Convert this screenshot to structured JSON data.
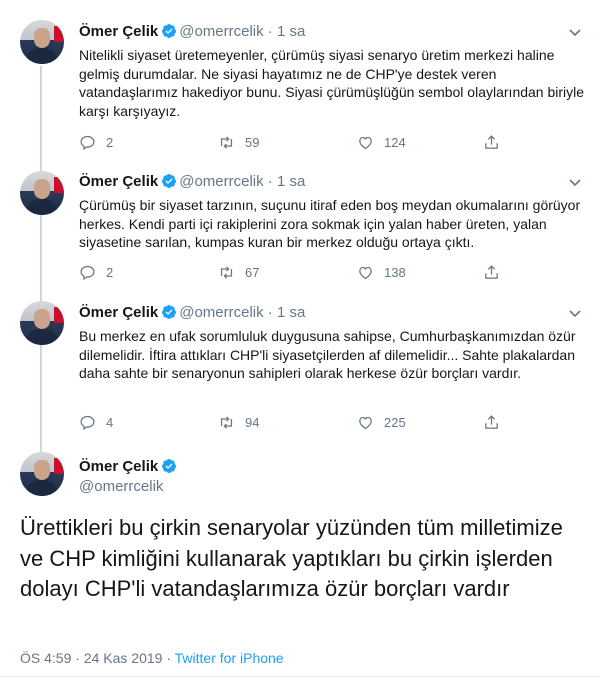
{
  "tweets": [
    {
      "name": "Ömer Çelik",
      "handle": "@omerrcelik",
      "dot": "·",
      "time": "1 sa",
      "text": "Nitelikli siyaset üretemeyenler, çürümüş siyasi senaryo üretim merkezi haline gelmiş durumdalar. Ne siyasi hayatımız ne de CHP'ye destek veren vatandaşlarımız hakediyor bunu. Siyasi çürümüşlüğün sembol olaylarından biriyle karşı karşıyayız.",
      "replies": "2",
      "retweets": "59",
      "likes": "124"
    },
    {
      "name": "Ömer Çelik",
      "handle": "@omerrcelik",
      "dot": "·",
      "time": "1 sa",
      "text": "Çürümüş bir siyaset tarzının, suçunu itiraf eden boş meydan okumalarını görüyor herkes. Kendi parti içi rakiplerini zora sokmak için yalan haber üreten, yalan siyasetine sarılan, kumpas kuran bir merkez olduğu ortaya çıktı.",
      "replies": "2",
      "retweets": "67",
      "likes": "138"
    },
    {
      "name": "Ömer Çelik",
      "handle": "@omerrcelik",
      "dot": "·",
      "time": "1 sa",
      "text": "Bu merkez en ufak sorumluluk duygusuna sahipse, Cumhurbaşkanımızdan özür dilemelidir. İftira attıkları CHP'li siyasetçilerden af dilemelidir... Sahte plakalardan daha sahte bir senaryonun sahipleri olarak herkese özür borçları vardır.",
      "replies": "4",
      "retweets": "94",
      "likes": "225"
    }
  ],
  "main": {
    "name": "Ömer Çelik",
    "handle": "@omerrcelik",
    "text": "Ürettikleri bu çirkin senaryolar yüzünden tüm milletimize ve CHP kimliğini kullanarak yaptıkları bu çirkin işlerden dolayı CHP'li vatandaşlarımıza özür borçları vardır",
    "time": "ÖS 4:59",
    "sep": "·",
    "date": "24 Kas 2019",
    "via": "Twitter for iPhone"
  },
  "colors": {
    "accent": "#1da1f2",
    "muted": "#657786",
    "text": "#14171a",
    "line": "#ccd6dd"
  },
  "icons": [
    "reply-icon",
    "retweet-icon",
    "like-icon",
    "share-icon",
    "verified-icon",
    "chevron-down-icon"
  ]
}
